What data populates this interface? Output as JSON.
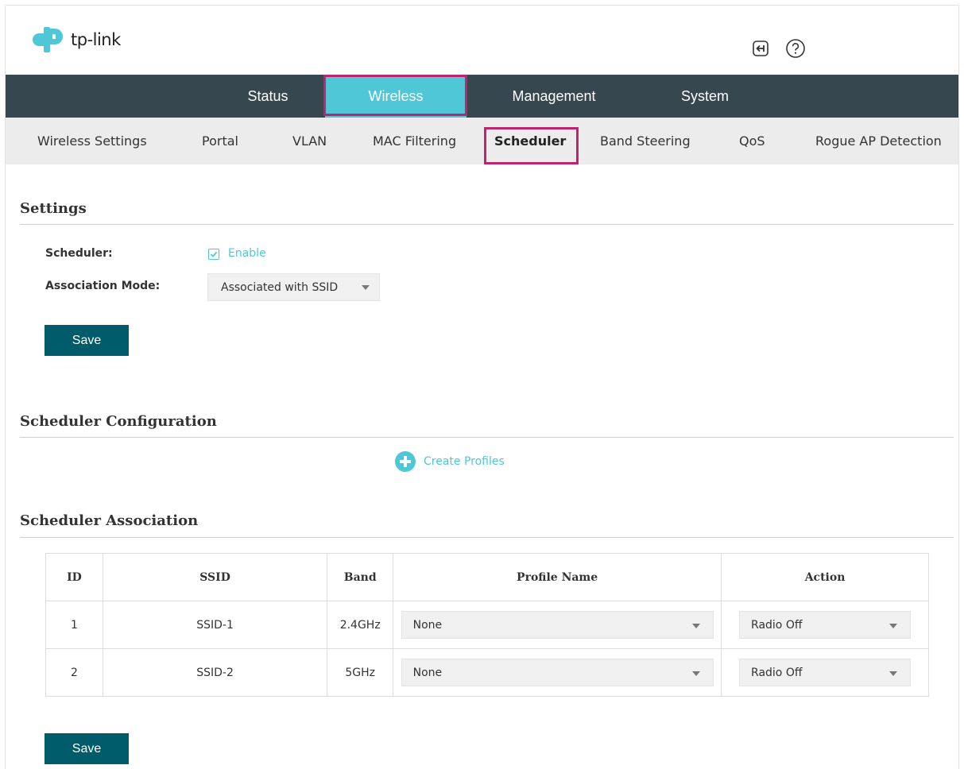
{
  "brand": {
    "logo_text": "tp-link"
  },
  "header_icons": [
    "logout-icon",
    "help-icon"
  ],
  "main_nav": {
    "tabs": [
      {
        "label": "Status"
      },
      {
        "label": "Wireless",
        "active": true
      },
      {
        "label": "Management"
      },
      {
        "label": "System"
      }
    ]
  },
  "sub_nav": {
    "tabs": [
      {
        "label": "Wireless Settings"
      },
      {
        "label": "Portal"
      },
      {
        "label": "VLAN"
      },
      {
        "label": "MAC Filtering"
      },
      {
        "label": "Scheduler",
        "active": true
      },
      {
        "label": "Band Steering"
      },
      {
        "label": "QoS"
      },
      {
        "label": "Rogue AP Detection"
      }
    ]
  },
  "settings": {
    "title": "Settings",
    "scheduler_label": "Scheduler:",
    "enable_label": "Enable",
    "enable_checked": true,
    "assoc_mode_label": "Association Mode:",
    "assoc_mode_value": "Associated with SSID",
    "save_label": "Save"
  },
  "config": {
    "title": "Scheduler Configuration",
    "create_label": "Create Profiles"
  },
  "association": {
    "title": "Scheduler Association",
    "columns": [
      "ID",
      "SSID",
      "Band",
      "Profile Name",
      "Action"
    ],
    "rows": [
      {
        "id": "1",
        "ssid": "SSID-1",
        "band": "2.4GHz",
        "profile": "None",
        "action": "Radio Off"
      },
      {
        "id": "2",
        "ssid": "SSID-2",
        "band": "5GHz",
        "profile": "None",
        "action": "Radio Off"
      }
    ],
    "save_label": "Save"
  },
  "colors": {
    "accent": "#4fc7d6",
    "nav_bg": "#36474f",
    "button": "#005b6b",
    "highlight": "#c0246f"
  }
}
